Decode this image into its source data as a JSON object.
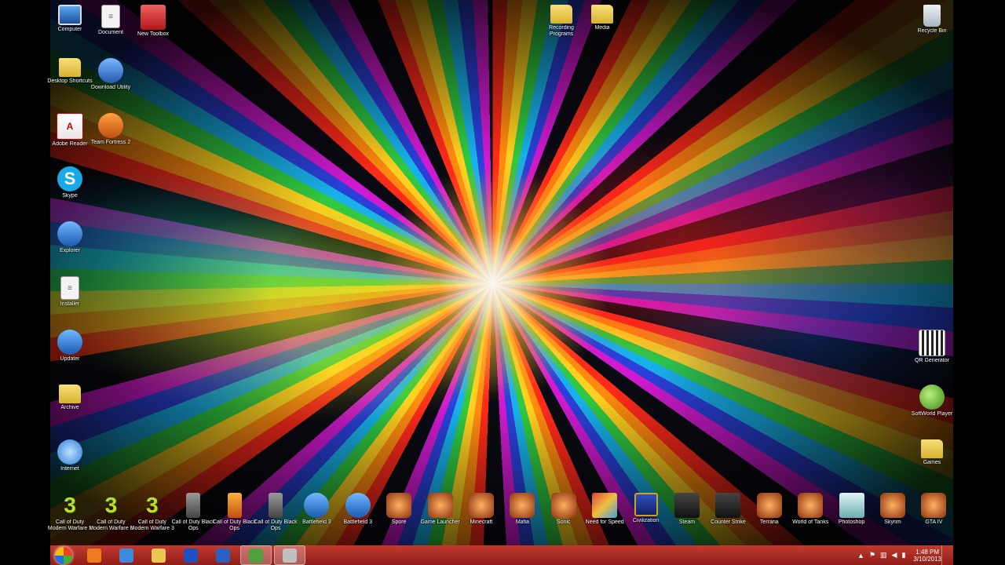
{
  "desktop": {
    "icons_left": [
      {
        "label": "Computer",
        "icon": "computer-icon"
      },
      {
        "label": "Document",
        "icon": "document-icon"
      },
      {
        "label": "New Toolbox",
        "icon": "toolbox-icon"
      },
      {
        "label": "Desktop Shortcuts",
        "icon": "folder-icon"
      },
      {
        "label": "Download Utility",
        "icon": "setup-icon"
      },
      {
        "label": "Adobe Reader",
        "icon": "pdf-icon"
      },
      {
        "label": "Team Fortress 2",
        "icon": "game-icon"
      },
      {
        "label": "Skype",
        "icon": "skype-icon"
      },
      {
        "label": "Explorer",
        "icon": "installer-icon"
      },
      {
        "label": "Installer",
        "icon": "document-icon"
      },
      {
        "label": "Updater",
        "icon": "installer-icon"
      },
      {
        "label": "Archive",
        "icon": "folder-icon"
      },
      {
        "label": "Internet",
        "icon": "ie-icon"
      }
    ],
    "icons_top_center": [
      {
        "label": "Recording Programs",
        "icon": "folder-icon"
      },
      {
        "label": "Media",
        "icon": "folder-icon"
      }
    ],
    "icons_right": [
      {
        "label": "Recycle Bin",
        "icon": "recycle-bin-icon"
      },
      {
        "label": "QR Generator",
        "icon": "qr-icon"
      },
      {
        "label": "SoftWorld Player",
        "icon": "green-orb-icon"
      },
      {
        "label": "Games",
        "icon": "folder-icon"
      }
    ],
    "icons_bottom": [
      {
        "label": "Call of Duty Modern Warfare 3",
        "icon": "game3-icon"
      },
      {
        "label": "Call of Duty Modern Warfare 3",
        "icon": "game3-icon"
      },
      {
        "label": "Call of Duty Modern Warfare 3",
        "icon": "game3-icon"
      },
      {
        "label": "Call of Duty Black Ops",
        "icon": "tower-icon"
      },
      {
        "label": "Call of Duty Black Ops",
        "icon": "orange-tower-icon"
      },
      {
        "label": "Call of Duty Black Ops",
        "icon": "tower-icon"
      },
      {
        "label": "Battlefield 3",
        "icon": "soldier-icon"
      },
      {
        "label": "Battlefield 3",
        "icon": "soldier-icon"
      },
      {
        "label": "Spore",
        "icon": "character-icon"
      },
      {
        "label": "Game Launcher",
        "icon": "character-icon"
      },
      {
        "label": "Minecraft",
        "icon": "character-icon"
      },
      {
        "label": "Mafia",
        "icon": "character-icon"
      },
      {
        "label": "Sonic",
        "icon": "character-icon"
      },
      {
        "label": "Need for Speed",
        "icon": "mixed-icon"
      },
      {
        "label": "Civilization",
        "icon": "navy-icon"
      },
      {
        "label": "Steam",
        "icon": "dark-icon"
      },
      {
        "label": "Counter Strike",
        "icon": "dark-icon"
      },
      {
        "label": "Terraria",
        "icon": "character-icon"
      },
      {
        "label": "World of Tanks",
        "icon": "character-icon"
      },
      {
        "label": "Photoshop",
        "icon": "teal-icon"
      },
      {
        "label": "Skyrim",
        "icon": "character-icon"
      },
      {
        "label": "GTA IV",
        "icon": "character-icon"
      }
    ]
  },
  "taskbar": {
    "start_label": "Start",
    "buttons": [
      {
        "name": "firefox",
        "color": "#f07a20"
      },
      {
        "name": "chrome",
        "color": "#3a8be0"
      },
      {
        "name": "explorer",
        "color": "#e8c850"
      },
      {
        "name": "media",
        "color": "#2050c0"
      },
      {
        "name": "app",
        "color": "#2a60c0"
      },
      {
        "name": "tool",
        "color": "#50a040",
        "active": true
      },
      {
        "name": "recorder",
        "color": "#c0c0c0",
        "active": true
      }
    ],
    "tray": {
      "icons": [
        "arrow-up-icon",
        "flag-icon",
        "network-icon",
        "volume-icon",
        "battery-icon"
      ],
      "time": "1:48 PM",
      "date": "3/10/2013"
    }
  },
  "colors": {
    "taskbar": "#a92a22",
    "icon_text": "#ffffff"
  }
}
